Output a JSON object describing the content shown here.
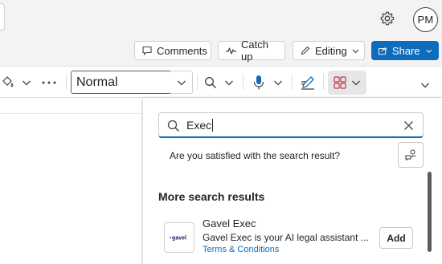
{
  "header": {
    "user_initials": "PM",
    "buttons": {
      "comments": "Comments",
      "catch_up": "Catch up",
      "editing": "Editing",
      "share": "Share"
    }
  },
  "toolbar": {
    "style_value": "Normal"
  },
  "addins_panel": {
    "search_value": "Exec",
    "satisfaction_question": "Are you satisfied with the search result?",
    "section_title": "More search results",
    "results": [
      {
        "name": "Gavel Exec",
        "description": "Gavel Exec is your AI legal assistant ...",
        "link": "Terms & Conditions",
        "action": "Add",
        "logo_text": "gavel"
      }
    ]
  },
  "colors": {
    "accent": "#0f6cbd",
    "background": "#f3f3f3"
  }
}
